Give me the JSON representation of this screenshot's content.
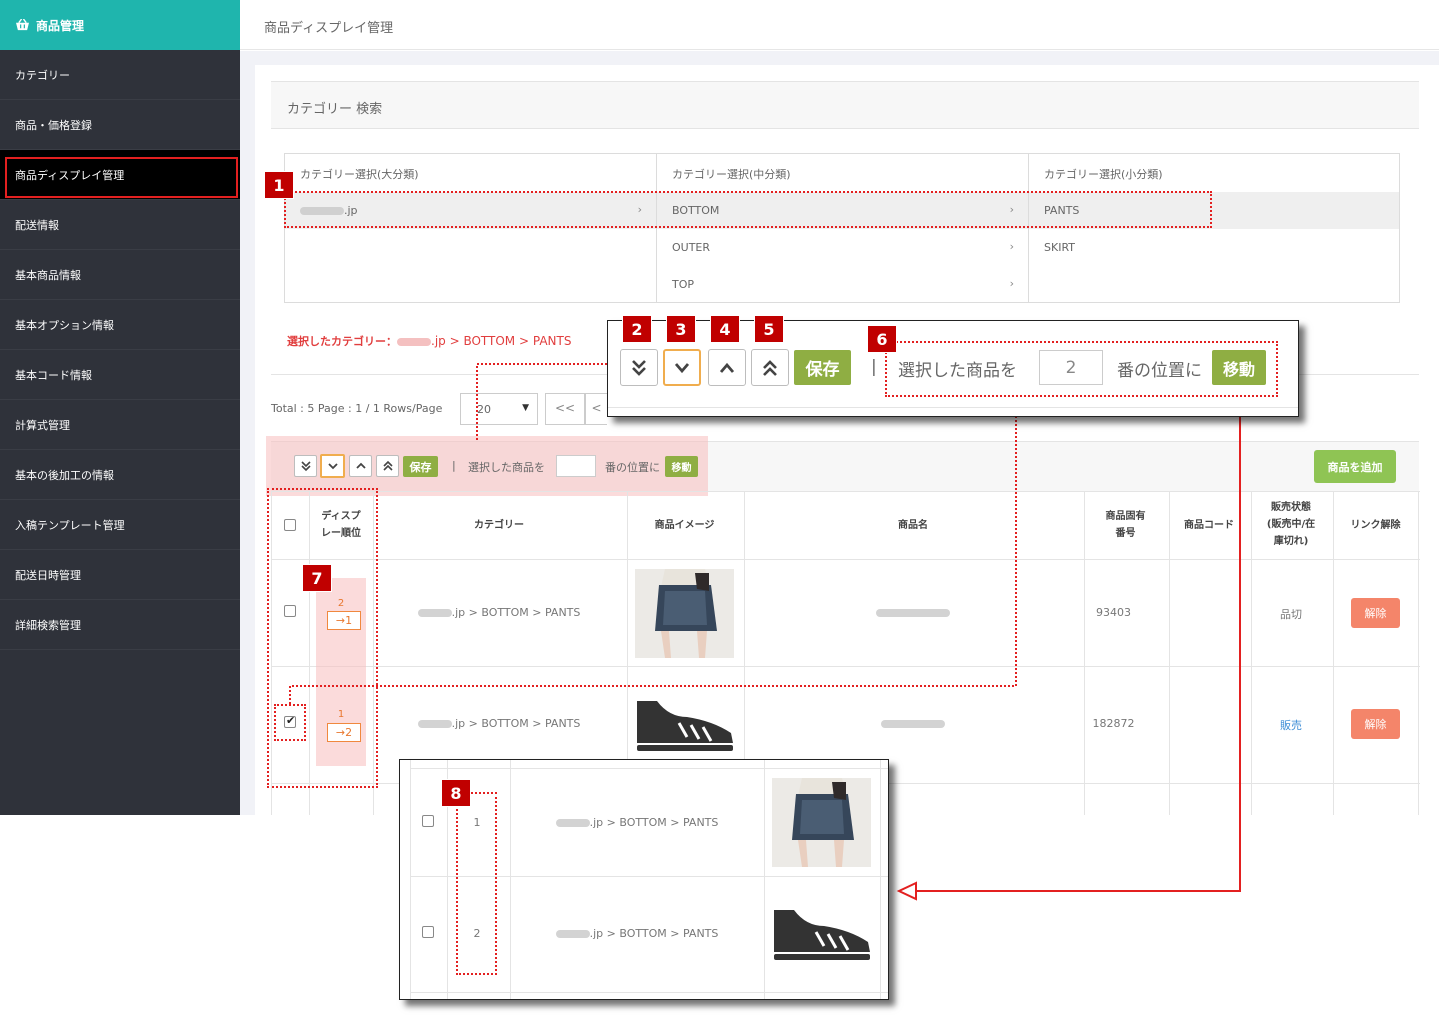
{
  "sidebar": {
    "brand": "商品管理",
    "items": [
      {
        "label": "カテゴリー"
      },
      {
        "label": "商品・価格登録"
      },
      {
        "label": "商品ディスプレイ管理"
      },
      {
        "label": "配送情報"
      },
      {
        "label": "基本商品情報"
      },
      {
        "label": "基本オプション情報"
      },
      {
        "label": "基本コード情報"
      },
      {
        "label": "計算式管理"
      },
      {
        "label": "基本の後加工の情報"
      },
      {
        "label": "入稿テンプレート管理"
      },
      {
        "label": "配送日時管理"
      },
      {
        "label": "詳細検索管理"
      }
    ]
  },
  "header": {
    "title": "商品ディスプレイ管理"
  },
  "search": {
    "title": "カテゴリー 検索",
    "col1": {
      "header": "カテゴリー選択(大分類)",
      "options": [
        ".jp"
      ]
    },
    "col2": {
      "header": "カテゴリー選択(中分類)",
      "options": [
        "BOTTOM",
        "OUTER",
        "TOP"
      ]
    },
    "col3": {
      "header": "カテゴリー選択(小分類)",
      "options": [
        "PANTS",
        "SKIRT"
      ]
    },
    "selected_label": "選択したカテゴリー：",
    "selected_path": ".jp > BOTTOM > PANTS"
  },
  "pager": {
    "total": "Total : 5  Page : 1 / 1 Rows/Page",
    "rows": "20",
    "first": "<<",
    "prev": "<"
  },
  "toolbar": {
    "save": "保存",
    "sep": "|",
    "text_before": "選択した商品を",
    "text_after": "番の位置に",
    "move": "移動",
    "add": "商品を追加"
  },
  "popup_toolbar": {
    "save": "保存",
    "sep": "|",
    "text_before": "選択した商品を",
    "position_value": "2",
    "text_after": "番の位置に",
    "move": "移動"
  },
  "table": {
    "headers": [
      "ディスプ",
      "レー順位",
      "カテゴリー",
      "商品イメージ",
      "商品名",
      "商品固有",
      "番号",
      "商品コード",
      "販売状態",
      "(販売中/在",
      "庫切れ)",
      "リンク解除"
    ],
    "rows": [
      {
        "old_order": "2",
        "new_order": "→1",
        "category": ".jp > BOTTOM > PANTS",
        "id": "93403",
        "status": "品切",
        "action": "解除",
        "checked": false
      },
      {
        "old_order": "1",
        "new_order": "→2",
        "category": ".jp > BOTTOM > PANTS",
        "id": "182872",
        "status": "販売",
        "action": "解除",
        "checked": true
      }
    ]
  },
  "result_popup": {
    "rows": [
      {
        "order": "1",
        "category": ".jp > BOTTOM > PANTS"
      },
      {
        "order": "2",
        "category": ".jp > BOTTOM > PANTS"
      }
    ]
  },
  "badges": [
    "1",
    "2",
    "3",
    "4",
    "5",
    "6",
    "7",
    "8"
  ],
  "colors": {
    "brand": "#1fb5ad",
    "sidebar": "#2f323a",
    "annotation": "#e32020",
    "badge": "#c00000",
    "green_button": "#8fae43",
    "add_button": "#8fc454",
    "delete_button": "#f4856a",
    "order_tag": "#f0883e"
  },
  "icons": [
    "basket-icon",
    "double-chevron-down-icon",
    "chevron-down-icon",
    "chevron-up-icon",
    "double-chevron-up-icon",
    "chevron-right-icon",
    "shoe-icon",
    "skirt-photo"
  ]
}
